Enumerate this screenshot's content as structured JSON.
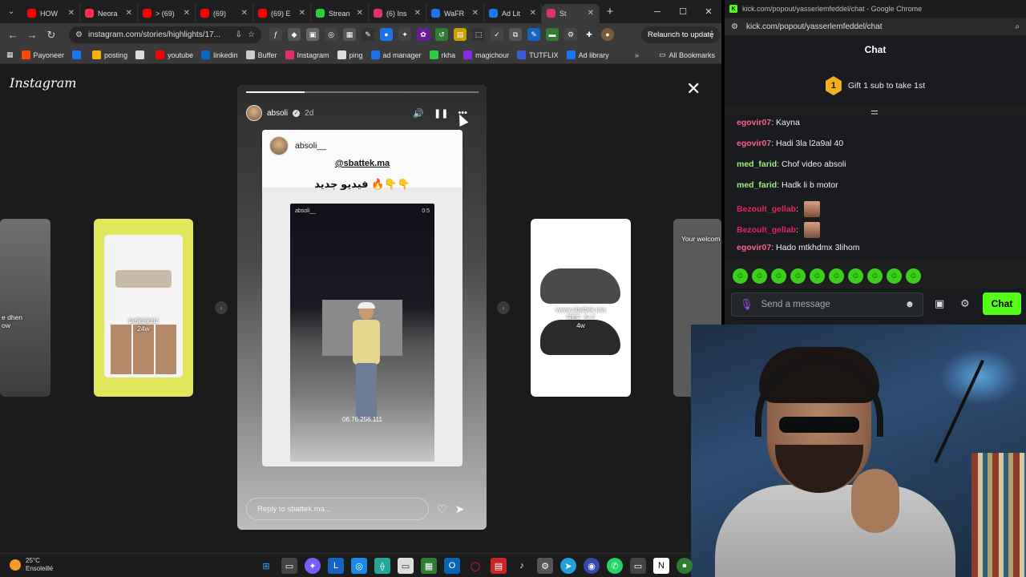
{
  "browser_left": {
    "tabs": [
      {
        "label": "HOW",
        "color": "#ff0000"
      },
      {
        "label": "Neora",
        "color": "#ff2a55"
      },
      {
        "label": "> (69)",
        "color": "#ff0000"
      },
      {
        "label": "(69) ",
        "color": "#ff0000"
      },
      {
        "label": "(69) E",
        "color": "#ff0000"
      },
      {
        "label": "Strean",
        "color": "#2ecc40"
      },
      {
        "label": "(6) Ins",
        "color": "#e1306c"
      },
      {
        "label": "WaFR",
        "color": "#1a73e8"
      },
      {
        "label": "Ad Lit",
        "color": "#1877f2"
      },
      {
        "label": "St",
        "color": "#e1306c",
        "active": true
      }
    ],
    "url": "instagram.com/stories/highlights/17...",
    "relaunch_label": "Relaunch to update",
    "bookmarks": [
      {
        "label": "Payoneer",
        "color": "#ff4800"
      },
      {
        "label": "",
        "color": "#1877f2"
      },
      {
        "label": "posting",
        "color": "#f4b400"
      },
      {
        "label": "",
        "color": "#dddddd"
      },
      {
        "label": "youtube",
        "color": "#ff0000"
      },
      {
        "label": "linkedin",
        "color": "#0a66c2"
      },
      {
        "label": "Buffer",
        "color": "#cccccc"
      },
      {
        "label": "Instagram",
        "color": "#e1306c"
      },
      {
        "label": "ping",
        "color": "#dddddd"
      },
      {
        "label": "ad manager",
        "color": "#1a73e8"
      },
      {
        "label": "rkha",
        "color": "#2ecc40"
      },
      {
        "label": "magichour",
        "color": "#8a2be2"
      },
      {
        "label": "TUTFLIX",
        "color": "#3b5bdb"
      },
      {
        "label": "Ad library",
        "color": "#1877f2"
      }
    ],
    "all_bookmarks_label": "All Bookmarks"
  },
  "instagram": {
    "logo": "Instagram",
    "side_cards": {
      "left_far_caption": "e dhen\now",
      "left_caption": "tarikiakziz\n24w",
      "right_caption": "www.sbattek.ma\nREF: S-2\n4w",
      "right_far_caption": "Your welcom"
    },
    "story": {
      "username": "absoli",
      "age": "2d",
      "progress": 0.25,
      "inner_username": "absoli__",
      "mention": "@sbattek.ma",
      "arabic_text": "فيديو جديد 🔥👇👇",
      "video_user": "absoli__",
      "video_time": "0:5",
      "phone": "06.76.256.111",
      "reply_placeholder": "Reply to sbattek.ma..."
    }
  },
  "kick": {
    "window_title": "kick.com/popout/yasserlemfeddel/chat - Google Chrome",
    "url": "kick.com/popout/yasserlemfeddel/chat",
    "header": "Chat",
    "gift_badge": "1",
    "gift_text": "Gift 1 sub to take 1st",
    "messages": [
      {
        "user": "egovir07",
        "color": "#ff5f8f",
        "text": "Kayna"
      },
      {
        "user": "egovir07",
        "color": "#ff5f8f",
        "text": "Hadi 3la l2a9al 40"
      },
      {
        "user": "med_farid",
        "color": "#9ef07a",
        "text": "Chof video absoli"
      },
      {
        "user": "med_farid",
        "color": "#9ef07a",
        "text": "Hadk li b motor"
      },
      {
        "user": "Bezoult_gellab",
        "color": "#e0245e",
        "text": "",
        "emote": true
      },
      {
        "user": "Bezoult_gellab",
        "color": "#e0245e",
        "text": "",
        "emote": true
      },
      {
        "user": "egovir07",
        "color": "#ff5f8f",
        "text": "Hado mtkhdmx 3lihom"
      }
    ],
    "input_placeholder": "Send a message",
    "chat_button": "Chat"
  },
  "taskbar": {
    "temperature": "25°C",
    "condition": "Ensoleillé"
  },
  "colors": {
    "kick_green": "#53fc18",
    "gift_gold": "#f2b01e"
  }
}
